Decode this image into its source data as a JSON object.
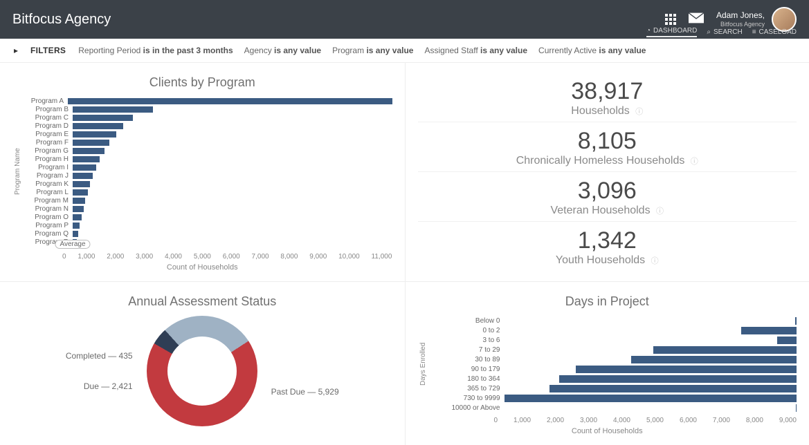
{
  "header": {
    "brand": "Bitfocus Agency",
    "user_name": "Adam Jones,",
    "user_org": "Bitfocus Agency",
    "nav": {
      "dashboard": "DASHBOARD",
      "search": "SEARCH",
      "caseload": "CASELOAD"
    }
  },
  "filters": {
    "label": "FILTERS",
    "items": [
      {
        "name": "Reporting Period",
        "value": "is in the past 3 months"
      },
      {
        "name": "Agency",
        "value": "is any value"
      },
      {
        "name": "Program",
        "value": "is any value"
      },
      {
        "name": "Assigned Staff",
        "value": "is any value"
      },
      {
        "name": "Currently Active",
        "value": "is any value"
      }
    ]
  },
  "kpis": [
    {
      "value": "38,917",
      "label": "Households"
    },
    {
      "value": "8,105",
      "label": "Chronically Homeless Households"
    },
    {
      "value": "3,096",
      "label": "Veteran Households"
    },
    {
      "value": "1,342",
      "label": "Youth Households"
    }
  ],
  "chart_data": [
    {
      "id": "clients_by_program",
      "type": "bar",
      "orientation": "horizontal",
      "title": "Clients by Program",
      "ylabel": "Program Name",
      "xlabel": "Count of Households",
      "xticks": [
        "0",
        "1,000",
        "2,000",
        "3,000",
        "4,000",
        "5,000",
        "6,000",
        "7,000",
        "8,000",
        "9,000",
        "10,000",
        "11,000"
      ],
      "xlim": [
        0,
        11000
      ],
      "annotations": [
        "Average"
      ],
      "categories": [
        "Program A",
        "Program B",
        "Program C",
        "Program D",
        "Program E",
        "Program F",
        "Program G",
        "Program H",
        "Program I",
        "Program J",
        "Program K",
        "Program L",
        "Program M",
        "Program N",
        "Program O",
        "Program P",
        "Program Q",
        "Program R"
      ],
      "values": [
        10800,
        2400,
        1800,
        1500,
        1300,
        1100,
        950,
        800,
        700,
        600,
        520,
        450,
        380,
        320,
        260,
        210,
        170,
        130
      ]
    },
    {
      "id": "annual_assessment_status",
      "type": "pie",
      "title": "Annual Assessment Status",
      "series": [
        {
          "name": "Completed",
          "value": 435,
          "color": "#2f3e55"
        },
        {
          "name": "Due",
          "value": 2421,
          "color": "#9fb2c4"
        },
        {
          "name": "Past Due",
          "value": 5929,
          "color": "#c23a3f"
        }
      ],
      "labels": {
        "completed": "Completed — 435",
        "due": "Due — 2,421",
        "past_due": "Past Due — 5,929"
      }
    },
    {
      "id": "days_in_project",
      "type": "bar",
      "orientation": "horizontal",
      "title": "Days in Project",
      "ylabel": "Days Enrolled",
      "xlabel": "Count of Households",
      "x_reversed": true,
      "xticks": [
        "9,000",
        "8,000",
        "7,000",
        "6,000",
        "5,000",
        "4,000",
        "3,000",
        "2,000",
        "1,000",
        "0"
      ],
      "xlim": [
        0,
        9000
      ],
      "categories": [
        "Below 0",
        "0 to 2",
        "3 to 6",
        "7 to 29",
        "30 to 89",
        "90 to 179",
        "180 to 364",
        "365 to 729",
        "730 to 9999",
        "10000 or Above"
      ],
      "values": [
        50,
        1700,
        600,
        4400,
        5100,
        6800,
        7300,
        7600,
        9000,
        20
      ]
    }
  ]
}
